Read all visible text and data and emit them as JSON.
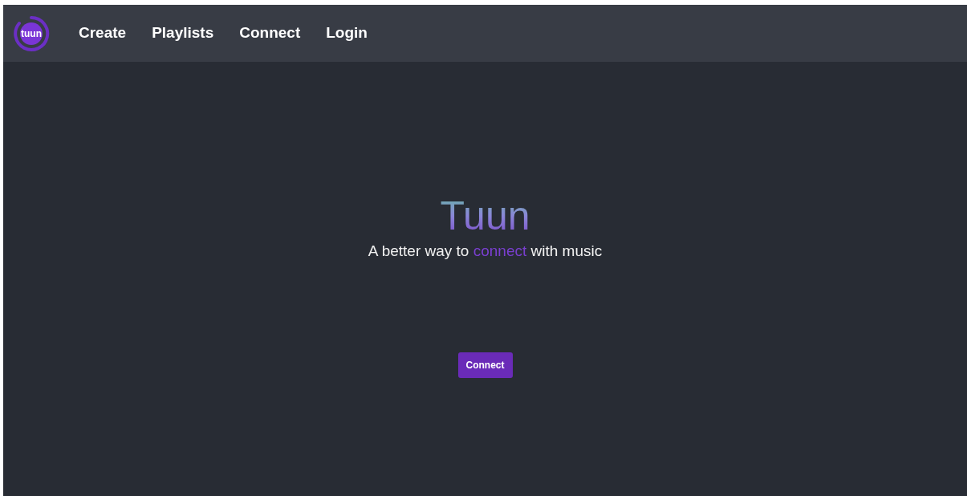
{
  "navbar": {
    "logo_text": "tuun",
    "links": [
      {
        "label": "Create"
      },
      {
        "label": "Playlists"
      },
      {
        "label": "Connect"
      },
      {
        "label": "Login"
      }
    ]
  },
  "hero": {
    "title": "Tuun",
    "tagline": [
      {
        "text": "A better way to ",
        "accent": false
      },
      {
        "text": "connect",
        "accent": true
      },
      {
        "text": " with music",
        "accent": false
      }
    ],
    "button": "Connect"
  }
}
